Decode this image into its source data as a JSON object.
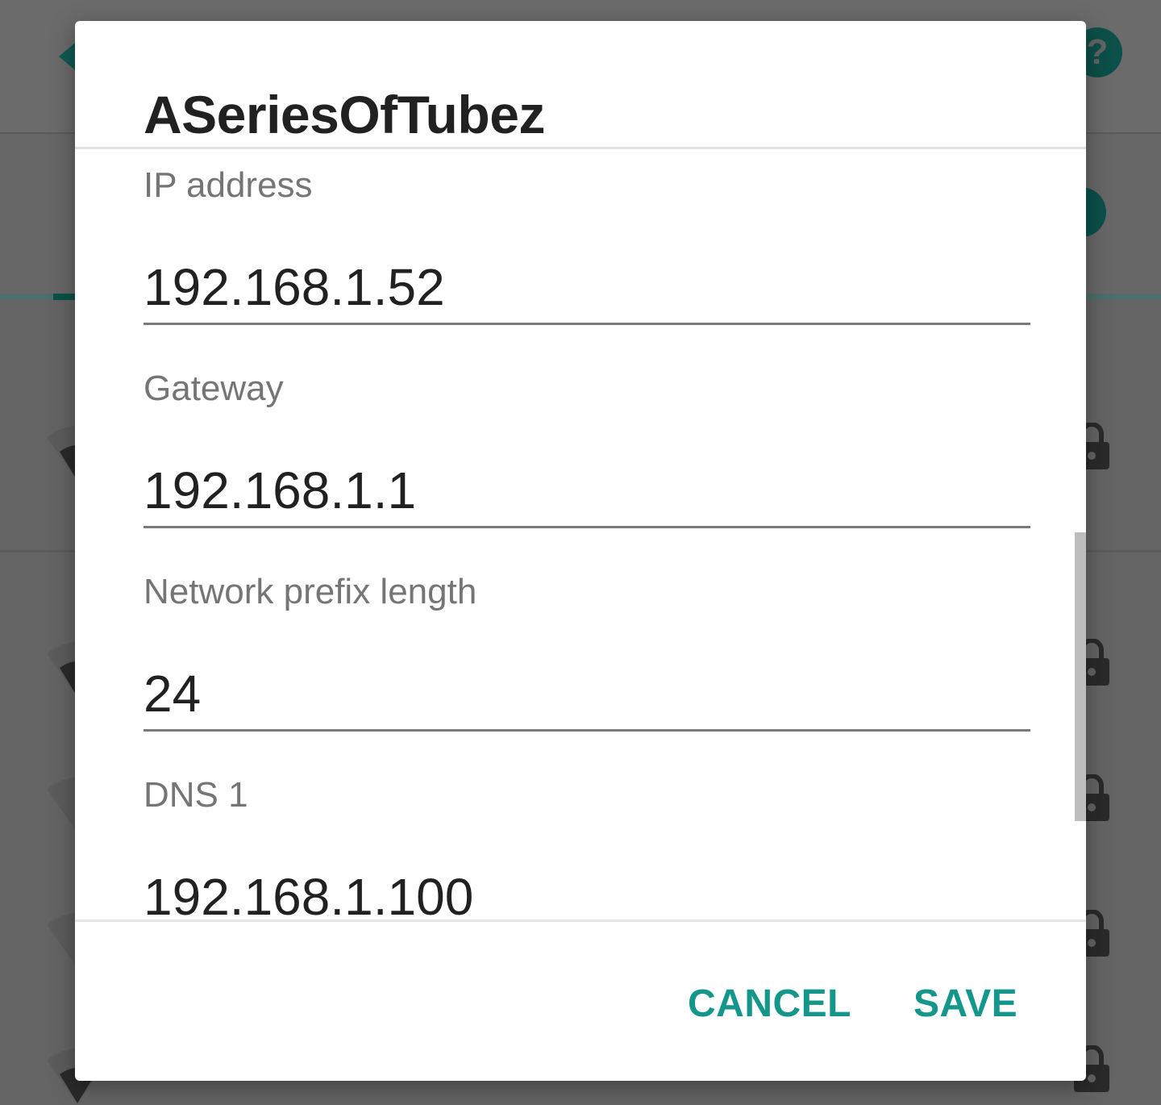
{
  "dialog": {
    "title": "ASeriesOfTubez",
    "fields": [
      {
        "label": "IP address",
        "value": "192.168.1.52"
      },
      {
        "label": "Gateway",
        "value": "192.168.1.1"
      },
      {
        "label": "Network prefix length",
        "value": "24"
      },
      {
        "label": "DNS 1",
        "value": "192.168.1.100"
      }
    ],
    "buttons": {
      "cancel": "CANCEL",
      "save": "SAVE"
    }
  },
  "background": {
    "help_icon": "?",
    "icons": [
      "back-arrow-icon",
      "help-icon",
      "wifi-icon",
      "lock-icon"
    ]
  },
  "colors": {
    "accent": "#14968a",
    "dark_teal": "#0c5049",
    "scrim": "#646464"
  }
}
